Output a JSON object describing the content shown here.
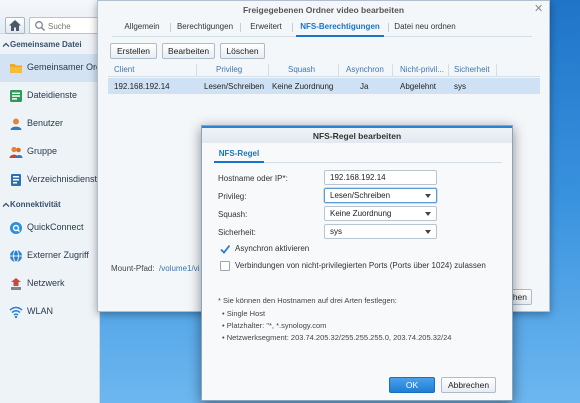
{
  "colors": {
    "accent": "#1a74c4",
    "selected_row": "#cfe2f5",
    "ok_button": "#2a86d8"
  },
  "sidebar": {
    "search_placeholder": "Suche",
    "sections": [
      {
        "label": "Gemeinsame Datei",
        "collapsed": false
      },
      {
        "label": "Konnektivität",
        "collapsed": false
      }
    ],
    "items": [
      {
        "label": "Gemeinsamer Ord",
        "icon": "shared-folder-icon",
        "active": true
      },
      {
        "label": "Dateidienste",
        "icon": "file-services-icon"
      },
      {
        "label": "Benutzer",
        "icon": "user-icon"
      },
      {
        "label": "Gruppe",
        "icon": "group-icon"
      },
      {
        "label": "Verzeichnisdienst",
        "icon": "directory-icon"
      },
      {
        "label": "QuickConnect",
        "icon": "quickconnect-icon"
      },
      {
        "label": "Externer Zugriff",
        "icon": "globe-icon"
      },
      {
        "label": "Netzwerk",
        "icon": "network-icon"
      },
      {
        "label": "WLAN",
        "icon": "wifi-icon"
      }
    ]
  },
  "window": {
    "title": "Freigegebenen Ordner video bearbeiten",
    "tabs": [
      "Allgemein",
      "Berechtigungen",
      "Erweitert",
      "NFS-Berechtigungen",
      "Datei neu ordnen"
    ],
    "active_tab": "NFS-Berechtigungen",
    "toolbar": {
      "create": "Erstellen",
      "edit": "Bearbeiten",
      "delete": "Löschen"
    },
    "table": {
      "columns": [
        "Client",
        "Privileg",
        "Squash",
        "Asynchron",
        "Nicht-privil...",
        "Sicherheit"
      ],
      "rows": [
        [
          "192.168.192.14",
          "Lesen/Schreiben",
          "Keine Zuordnung",
          "Ja",
          "Abgelehnt",
          "sys"
        ]
      ]
    },
    "mount_label": "Mount-Pfad:",
    "mount_value": "/volume1/vide",
    "partial_button": "hen"
  },
  "dialog": {
    "title": "NFS-Regel bearbeiten",
    "tab": "NFS-Regel",
    "fields": {
      "hostname": {
        "label": "Hostname oder IP*:",
        "value": "192.168.192.14"
      },
      "privilege": {
        "label": "Privileg:",
        "value": "Lesen/Schreiben"
      },
      "squash": {
        "label": "Squash:",
        "value": "Keine Zuordnung"
      },
      "security": {
        "label": "Sicherheit:",
        "value": "sys"
      }
    },
    "checkboxes": [
      {
        "label": "Asynchron aktivieren",
        "checked": true
      },
      {
        "label": "Verbindungen von nicht-privilegierten Ports (Ports über 1024) zulassen",
        "checked": false
      }
    ],
    "note": "* Sie können den Hostnamen auf drei Arten festlegen:",
    "bullets": [
      "Single Host",
      "Platzhalter: \"*, *.synology.com",
      "Netzwerksegment: 203.74.205.32/255.255.255.0, 203.74.205.32/24"
    ],
    "ok": "OK",
    "cancel": "Abbrechen"
  }
}
